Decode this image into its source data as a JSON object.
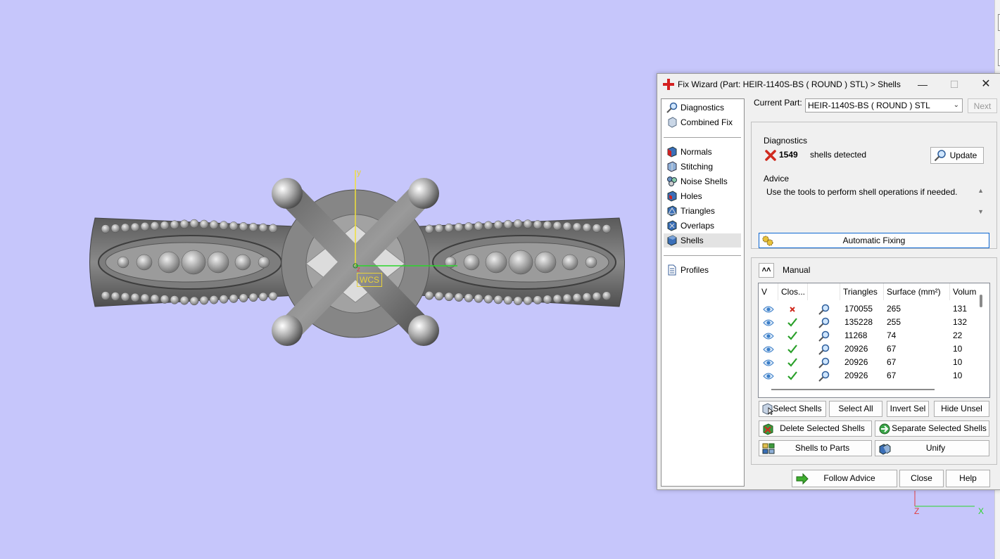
{
  "viewport": {
    "wcs_label": "WCS",
    "axis_y": "y",
    "axis_z": "z",
    "corner_axis_z": "Z",
    "corner_axis_x": "X",
    "background": "#c6c6fb"
  },
  "window": {
    "title": "Fix Wizard (Part: HEIR-1140S-BS ( ROUND )    STL) > Shells",
    "minimize_icon": "minimize-icon",
    "maximize_icon": "maximize-icon",
    "close_icon": "close-icon"
  },
  "nav": {
    "items": [
      {
        "label": "Diagnostics",
        "icon": "magnifier-icon"
      },
      {
        "label": "Combined Fix",
        "icon": "cube-icon"
      },
      {
        "label": "Normals",
        "icon": "normals-icon"
      },
      {
        "label": "Stitching",
        "icon": "stitching-icon"
      },
      {
        "label": "Noise Shells",
        "icon": "noise-shells-icon"
      },
      {
        "label": "Holes",
        "icon": "holes-icon"
      },
      {
        "label": "Triangles",
        "icon": "triangles-icon"
      },
      {
        "label": "Overlaps",
        "icon": "overlaps-icon"
      },
      {
        "label": "Shells",
        "icon": "shells-icon",
        "selected": true
      },
      {
        "label": "Profiles",
        "icon": "document-icon"
      }
    ]
  },
  "current_part": {
    "label": "Current Part:",
    "value": "HEIR-1140S-BS ( ROUND )    STL",
    "next_label": "Next"
  },
  "diagnostics": {
    "group_label": "Diagnostics",
    "count": "1549",
    "status_text": "shells detected",
    "update_label": "Update",
    "advice_label": "Advice",
    "advice_text": "Use the tools to perform shell operations if needed.",
    "automatic_fixing_label": "Automatic Fixing"
  },
  "manual": {
    "label": "Manual",
    "columns": [
      "V",
      "Clos...",
      "",
      "Triangles",
      "Surface (mm²)",
      "Volum"
    ],
    "rows": [
      {
        "closed": false,
        "triangles": "170055",
        "surface": "265",
        "volume": "131"
      },
      {
        "closed": true,
        "triangles": "135228",
        "surface": "255",
        "volume": "132"
      },
      {
        "closed": true,
        "triangles": "11268",
        "surface": "74",
        "volume": "22"
      },
      {
        "closed": true,
        "triangles": "20926",
        "surface": "67",
        "volume": "10"
      },
      {
        "closed": true,
        "triangles": "20926",
        "surface": "67",
        "volume": "10"
      },
      {
        "closed": true,
        "triangles": "20926",
        "surface": "67",
        "volume": "10"
      }
    ],
    "buttons": {
      "select_shells": "Select Shells",
      "select_all": "Select All",
      "invert_sel": "Invert Sel",
      "hide_unsel": "Hide Unsel",
      "delete_selected": "Delete Selected Shells",
      "separate_selected": "Separate Selected Shells",
      "shells_to_parts": "Shells to Parts",
      "unify": "Unify"
    }
  },
  "footer": {
    "follow_advice": "Follow Advice",
    "close": "Close",
    "help": "Help"
  }
}
